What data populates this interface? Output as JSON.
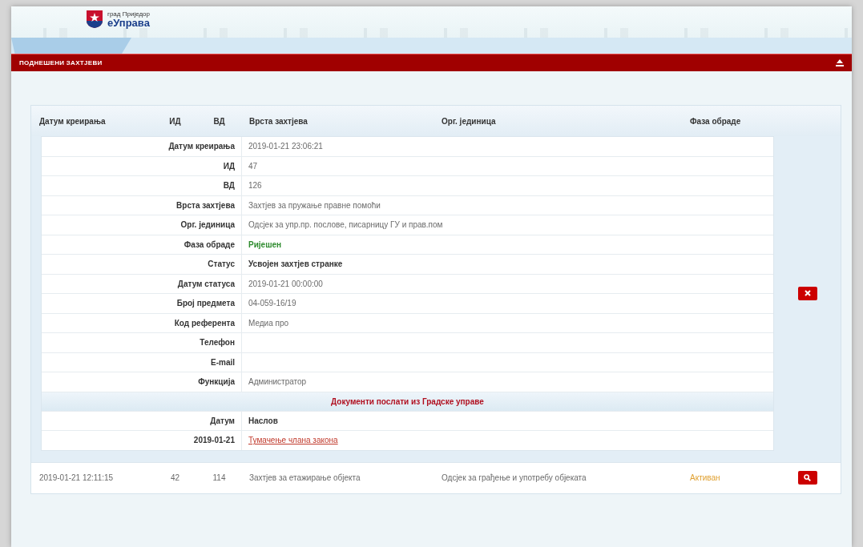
{
  "header": {
    "logo_caption": "град Приједор",
    "logo_title": "еУправа"
  },
  "panel": {
    "title": "ПОДНЕШЕНИ ЗАХТЈЕВИ"
  },
  "table": {
    "columns": [
      "Датум креирања",
      "ИД",
      "ВД",
      "Врста захтјева",
      "Орг. јединица",
      "Фаза обраде"
    ],
    "rows": [
      {
        "expanded": true,
        "details": {
          "fields": [
            {
              "label": "Датум креирања",
              "value": "2019-01-21 23:06:21",
              "kind": "plain"
            },
            {
              "label": "ИД",
              "value": "47",
              "kind": "plain"
            },
            {
              "label": "ВД",
              "value": "126",
              "kind": "plain"
            },
            {
              "label": "Врста захтјева",
              "value": "Захтјев за пружање правне помоћи",
              "kind": "plain"
            },
            {
              "label": "Орг. јединица",
              "value": "Одсјек за упр.пр. послове, писарницу ГУ и прав.пом",
              "kind": "plain"
            },
            {
              "label": "Фаза обраде",
              "value": "Ријешен",
              "kind": "colored",
              "color": "#2e8b2e"
            },
            {
              "label": "Статус",
              "value": "Усвојен захтјев странке",
              "kind": "strong"
            },
            {
              "label": "Датум статуса",
              "value": "2019-01-21 00:00:00",
              "kind": "plain"
            },
            {
              "label": "Број предмета",
              "value": "04-059-16/19",
              "kind": "plain"
            },
            {
              "label": "Код референта",
              "value": "Медиа про",
              "kind": "plain"
            },
            {
              "label": "Телефон",
              "kind": "plain"
            },
            {
              "label": "E-mail",
              "kind": "plain"
            },
            {
              "label": "Функција",
              "value": "Администратор",
              "kind": "plain"
            }
          ],
          "documents_title": "Документи послати из Градске управе",
          "document_columns": [
            "Датум",
            "Наслов"
          ],
          "documents": [
            {
              "date": "2019-01-21",
              "title": "Тумачење члана закона"
            }
          ]
        },
        "kind": "delete"
      },
      {
        "expanded": false,
        "cells": [
          {
            "text": "2019-01-21 12:11:15"
          },
          {
            "text": "42"
          },
          {
            "text": "114"
          },
          {
            "text": "Захтјев за етажирање објекта"
          },
          {
            "text": "Одсјек за грађење и употребу објеката"
          },
          {
            "text": "Активан",
            "color": "#e0a030"
          }
        ],
        "kind": "search"
      }
    ]
  }
}
